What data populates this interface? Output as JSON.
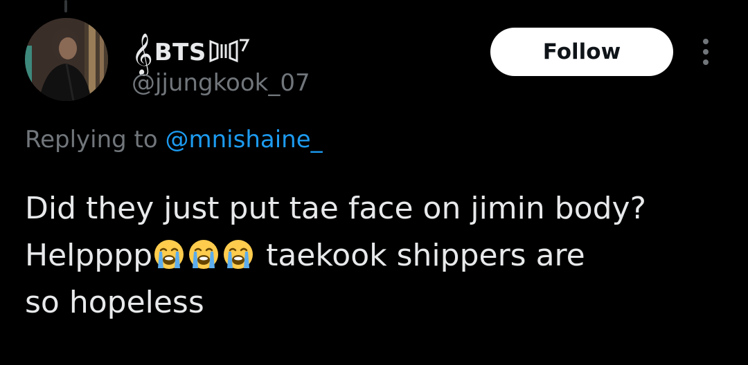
{
  "thread": {
    "connector": "thread-line"
  },
  "author": {
    "avatar_icon": "profile-photo",
    "clef_glyph": "𝄞",
    "display_name": "BTS",
    "emblem_icon": "bts-emblem-7-icon",
    "handle": "@jjungkook_07"
  },
  "actions": {
    "follow_label": "Follow",
    "more_icon": "more-vertical-icon"
  },
  "reply": {
    "prefix": "Replying to ",
    "mention": "@mnishaine_"
  },
  "tweet": {
    "line1": "Did they just put tae face on jimin body?",
    "line2_start": "Helpppp",
    "emoji_icon": "loudly-crying-face-icon",
    "emoji_count": 3,
    "line2_end": " taekook shippers are",
    "line3": "so hopeless"
  },
  "colors": {
    "background": "#000000",
    "text_primary": "#e7e9ea",
    "text_secondary": "#71767b",
    "accent_link": "#1d9bf0",
    "follow_button_bg": "#ffffff",
    "follow_button_text": "#0f1419"
  }
}
